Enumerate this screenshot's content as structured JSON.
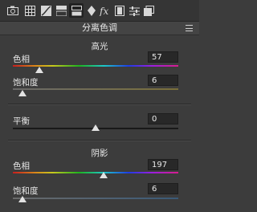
{
  "toolbar": {
    "tools": [
      {
        "name": "histogram-camera-icon"
      },
      {
        "name": "basic-adjust-icon"
      },
      {
        "name": "tone-curve-icon"
      },
      {
        "name": "hsl-icon"
      },
      {
        "name": "split-toning-icon",
        "active": true
      },
      {
        "name": "detail-icon"
      },
      {
        "name": "fx-effects-icon"
      },
      {
        "name": "camera-calibration-icon"
      },
      {
        "name": "presets-icon"
      },
      {
        "name": "snapshots-icon"
      }
    ]
  },
  "panel": {
    "title": "分离色调",
    "highlights": {
      "title": "高光",
      "hue_label": "色相",
      "hue_value": "57",
      "hue_fraction": 0.16,
      "saturation_label": "饱和度",
      "saturation_value": "6",
      "saturation_fraction": 0.06
    },
    "balance": {
      "label": "平衡",
      "value": "0",
      "fraction": 0.5
    },
    "shadows": {
      "title": "阴影",
      "hue_label": "色相",
      "hue_value": "197",
      "hue_fraction": 0.55,
      "saturation_label": "饱和度",
      "saturation_value": "6",
      "saturation_fraction": 0.06
    }
  }
}
